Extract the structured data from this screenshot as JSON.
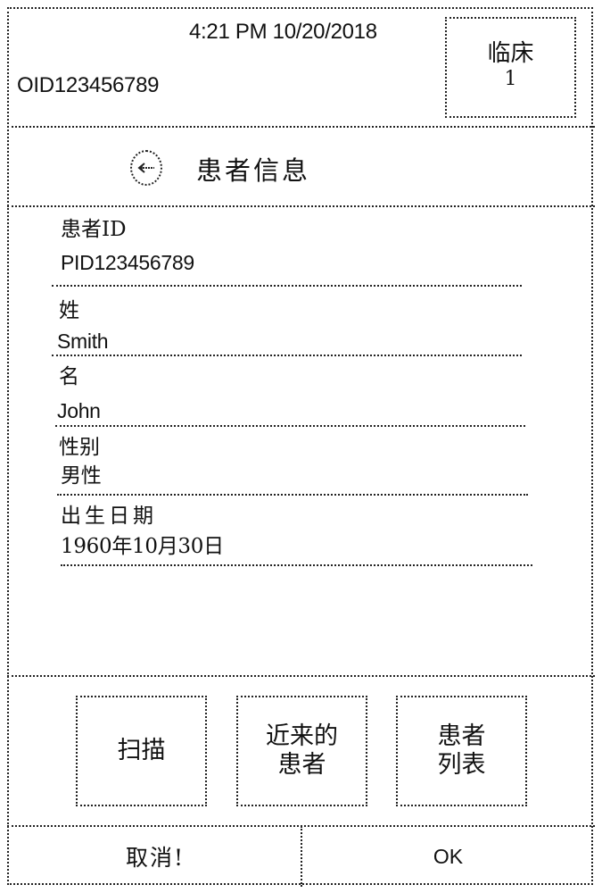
{
  "header": {
    "datetime": "4:21 PM 10/20/2018",
    "operator_id": "OID123456789",
    "clinic": {
      "label": "临床",
      "number": "1"
    }
  },
  "title_bar": {
    "back_icon": "left-arrow-circle-icon",
    "title": "患者信息"
  },
  "patient_fields": [
    {
      "label": "患者ID",
      "value": "PID123456789"
    },
    {
      "label": "姓",
      "value": "Smith"
    },
    {
      "label": "名",
      "value": "John"
    },
    {
      "label": "性别",
      "value": "男性"
    },
    {
      "label": "出生日期",
      "value": "1960年10月30日"
    }
  ],
  "actions": {
    "scan": {
      "lines": [
        "扫描"
      ]
    },
    "recent_patients": {
      "lines": [
        "近来的",
        "患者"
      ]
    },
    "patient_list": {
      "lines": [
        "患者",
        "列表"
      ]
    }
  },
  "footer": {
    "cancel_label": "取消!",
    "ok_label": "OK"
  }
}
